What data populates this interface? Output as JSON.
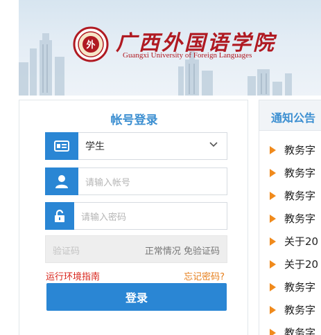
{
  "banner": {
    "logo_cn": "广西外国语学院",
    "logo_en": "Guangxi University of Foreign Languages",
    "seal_char": "外"
  },
  "login": {
    "title": "帐号登录",
    "role_selected": "学生",
    "account_placeholder": "请输入帐号",
    "password_placeholder": "请输入密码",
    "captcha_placeholder": "验证码",
    "captcha_note": "正常情况 免验证码",
    "env_link": "运行环境指南",
    "forgot_link": "忘记密码?",
    "submit_label": "登录"
  },
  "notices": {
    "title": "通知公告",
    "items": [
      {
        "text": "教务字"
      },
      {
        "text": "教务字"
      },
      {
        "text": "教务字"
      },
      {
        "text": "教务字"
      },
      {
        "text": "关于20"
      },
      {
        "text": "关于20"
      },
      {
        "text": "教务字"
      },
      {
        "text": "教务字"
      },
      {
        "text": "教务字"
      }
    ]
  },
  "colors": {
    "primary": "#2a86d4",
    "title_blue": "#3c8fd1",
    "brand_red": "#b01a22",
    "link_red": "#d8231a",
    "link_orange": "#e67e1a",
    "arrow_orange": "#f08a1c"
  },
  "icons": {
    "role": "id-card-icon",
    "account": "user-icon",
    "password": "lock-icon",
    "select": "chevron-down-icon",
    "notice": "triangle-right-icon"
  }
}
